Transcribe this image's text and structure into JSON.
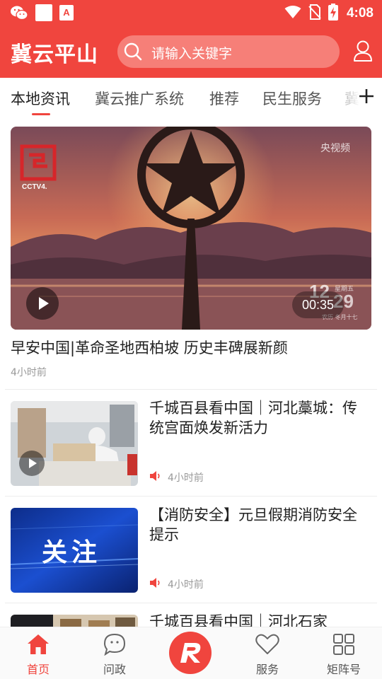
{
  "status_bar": {
    "time": "4:08",
    "icons": [
      "wechat-icon",
      "square-icon",
      "app-a-icon",
      "wifi-icon",
      "no-sim-icon",
      "battery-charging-icon"
    ],
    "app_a_glyph": "A"
  },
  "header": {
    "title": "冀云平山",
    "search_placeholder": "请输入关键字",
    "accent_color": "#f0453e"
  },
  "tabs": [
    {
      "label": "本地资讯",
      "active": true
    },
    {
      "label": "冀云推广系统",
      "active": false
    },
    {
      "label": "推荐",
      "active": false
    },
    {
      "label": "民生服务",
      "active": false
    },
    {
      "label": "冀",
      "active": false
    }
  ],
  "feed": {
    "hero": {
      "title": "早安中国|革命圣地西柏坡 历史丰碑展新颜",
      "time": "4小时前",
      "duration": "00:35",
      "channel_logo": "CCTV4.",
      "watermark": "央视频",
      "date_overlay_day": "12",
      "date_overlay_num": "29",
      "date_overlay_weekday": "星期五",
      "date_overlay_lunar": "农历 冬月十七"
    },
    "items": [
      {
        "title": "千城百县看中国｜河北藁城：传统宫面焕发新活力",
        "time": "4小时前",
        "has_video": true
      },
      {
        "title": "【消防安全】元旦假期消防安全提示",
        "time": "4小时前",
        "has_video": false,
        "thumb_text": "关注"
      },
      {
        "title": "千城百县看中国｜河北石家",
        "time": "",
        "has_video": false
      }
    ]
  },
  "bottom_nav": [
    {
      "label": "首页",
      "icon": "home-icon",
      "active": true
    },
    {
      "label": "问政",
      "icon": "chat-bubble-icon",
      "active": false
    },
    {
      "label": "",
      "icon": "app-logo-icon",
      "active": false
    },
    {
      "label": "服务",
      "icon": "heart-icon",
      "active": false
    },
    {
      "label": "矩阵号",
      "icon": "grid-icon",
      "active": false
    }
  ]
}
